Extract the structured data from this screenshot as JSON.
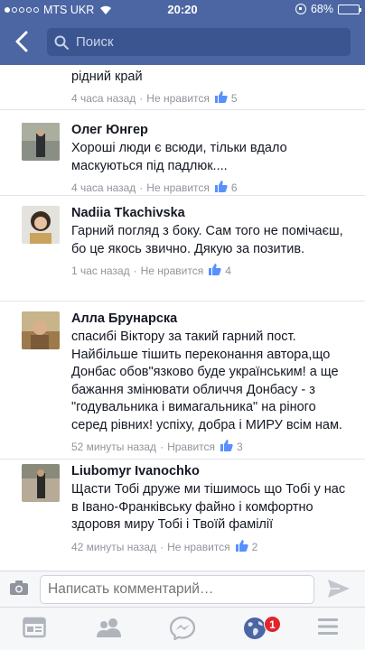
{
  "status_bar": {
    "carrier": "MTS UKR",
    "time": "20:20",
    "battery": "68%",
    "battery_level": 0.68
  },
  "nav": {
    "search_placeholder": "Поиск"
  },
  "comments": [
    {
      "author": "",
      "text": "Дуже приємно почути позитивні відгуки про рідний край",
      "time": "4 часа назад",
      "action": "Не нравится",
      "likes": "5"
    },
    {
      "author": "Олег Юнгер",
      "text": "Хороші люди є всюди, тільки вдало маскуються під падлюк....",
      "time": "4 часа назад",
      "action": "Не нравится",
      "likes": "6"
    },
    {
      "author": "Nadiia Tkachivska",
      "text": "Гарний погляд з боку. Сам того не помічаєш, бо це якось звично. Дякую за позитив.",
      "time": "1 час назад",
      "action": "Не нравится",
      "likes": "4"
    },
    {
      "author": "Алла Брунарска",
      "text": "спасибі Віктору за такий гарний пост. Найбільше тішить переконання автора,що Донбас обов\"язково буде українським! а ще бажання змінювати обличчя Донбасу - з \"годувальника і вимагальника\" на ріного серед рівних! успіху, добра і МИРУ всім нам.",
      "time": "52 минуты назад",
      "action": "Нравится",
      "likes": "3"
    },
    {
      "author": "Liubomyr Ivanochko",
      "text": "Щасти Тобі друже ми тішимось що Тобі у нас в Івано-Франківську файно і комфортно здоровя миру Тобі і Твоїй фамілії",
      "time": "42 минуты назад",
      "action": "Не нравится",
      "likes": "2"
    }
  ],
  "composer": {
    "placeholder": "Написать комментарий…"
  },
  "tabbar": {
    "notifications_badge": "1"
  },
  "colors": {
    "brand": "#4c66a4",
    "like": "#5890ff",
    "badge": "#e0262b"
  }
}
